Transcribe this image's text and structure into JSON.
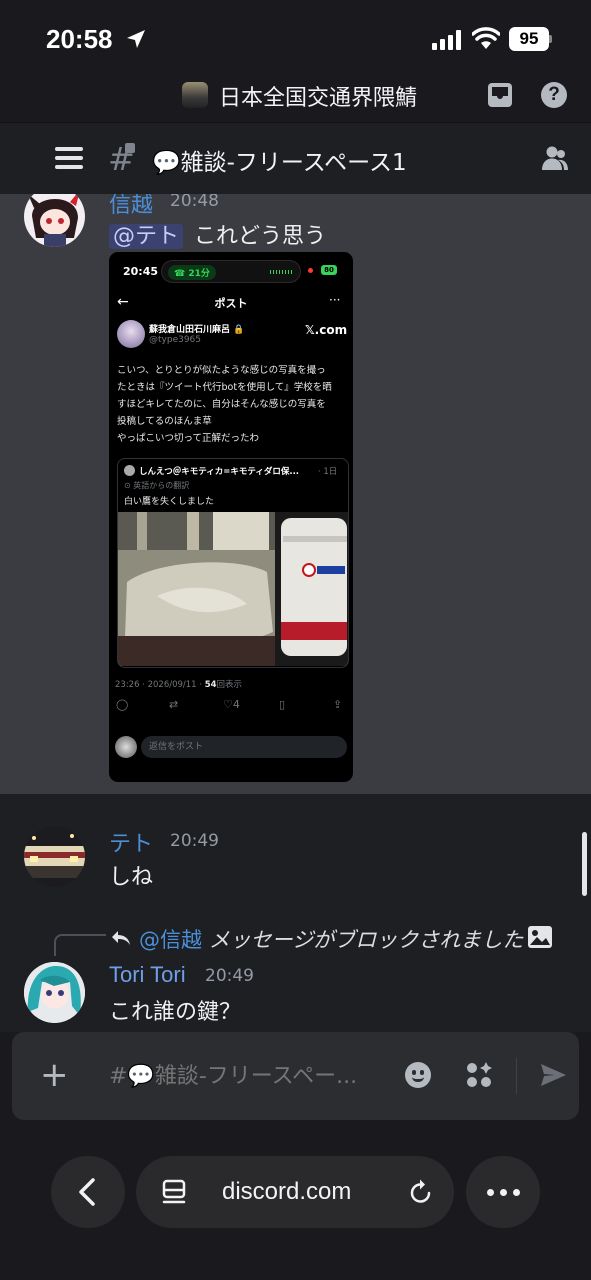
{
  "status_bar": {
    "time": "20:58",
    "battery": "95"
  },
  "server": {
    "name": "日本全国交通界隈鯖"
  },
  "channel": {
    "name": "💬雑談-フリースペース1"
  },
  "messages": [
    {
      "author": "信越",
      "author_color": "#4b8fd9",
      "time": "20:48",
      "mention": "@テト",
      "text": "これどう思う"
    },
    {
      "author": "テト",
      "author_color": "#4b8fd9",
      "time": "20:49",
      "text": "しね"
    },
    {
      "reply_to": "@信越",
      "reply_text": "メッセージがブロックされました",
      "author": "Tori Tori",
      "author_color": "#6f9fe8",
      "time": "20:49",
      "text": "これ誰の鍵？"
    }
  ],
  "embed": {
    "phone_time": "20:45",
    "call_duration": "21分",
    "battery": "80",
    "page_title": "ポスト",
    "author": "蘇我倉山田石川麻呂",
    "handle": "@type3965",
    "brand": "𝕏.com",
    "body_lines": [
      "こいつ、とりとりが似たような感じの写真を撮っ",
      "たときは『ツイート代行botを使用して』学校を晒",
      "すほどキレてたのに、自分はそんな感じの写真を",
      "投稿してるのほんま草",
      "やっぱこいつ切って正解だったわ"
    ],
    "quote": {
      "author": "しんえつ＠キモティカ=キモティダロ保...",
      "age": "· 1日",
      "translated": "⊙ 英語からの翻訳",
      "text": "白い鷹を失くしました"
    },
    "meta_prefix": "23:26 · 2026/09/11 · ",
    "views": "54",
    "views_suffix": "回表示",
    "likes": "4",
    "reply_placeholder": "返信をポスト"
  },
  "composer": {
    "placeholder": "#💬雑談-フリースペー..."
  },
  "browser": {
    "url": "discord.com"
  },
  "colors": {
    "accent_link": "#4b8fd9",
    "mention_bg": "#3c4270"
  },
  "icons": [
    "location-arrow-icon",
    "signal-icon",
    "wifi-icon",
    "inbox-icon",
    "help-icon",
    "menu-icon",
    "channel-hash-icon",
    "members-icon",
    "reply-arrow-icon",
    "image-icon",
    "plus-icon",
    "emoji-icon",
    "apps-icon",
    "send-icon",
    "back-icon",
    "tabs-icon",
    "reload-icon",
    "more-icon"
  ]
}
